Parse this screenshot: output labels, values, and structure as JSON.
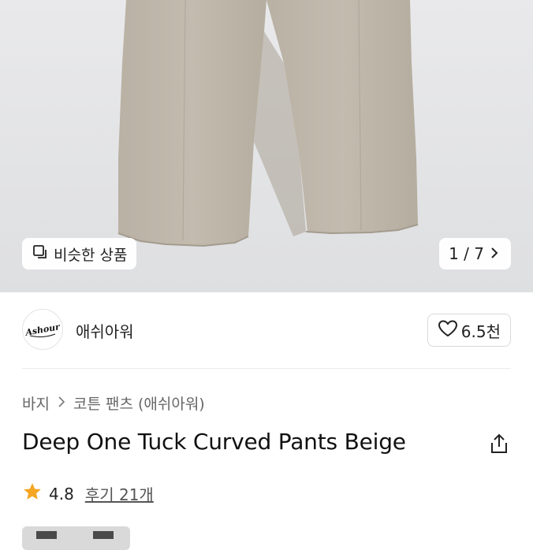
{
  "gallery": {
    "similar_label": "비슷한 상품",
    "counter": "1 / 7"
  },
  "brand": {
    "logo_text": "Ashour",
    "name": "애쉬아워",
    "likes": "6.5천"
  },
  "breadcrumb": {
    "items": [
      "바지",
      "코튼 팬츠 (애쉬아워)"
    ]
  },
  "product": {
    "title": "Deep One Tuck Curved Pants Beige",
    "rating": "4.8",
    "reviews": "후기 21개"
  },
  "colors": {
    "accent_star": "#f5a623",
    "pants": "#bdb5a8"
  },
  "icons": [
    "similar-icon",
    "chevron-right-icon",
    "heart-icon",
    "share-icon",
    "star-icon"
  ]
}
